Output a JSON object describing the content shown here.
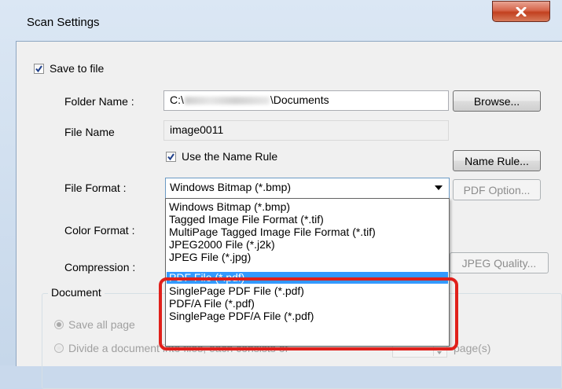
{
  "window": {
    "title": "Scan Settings",
    "close_icon": "close-x-icon"
  },
  "save_to_file": {
    "label": "Save to file",
    "checked": true
  },
  "folder": {
    "label": "Folder Name :",
    "value_prefix": "C:\\",
    "value_suffix": "\\Documents",
    "browse_label": "Browse..."
  },
  "file_name": {
    "label": "File Name",
    "value": "image0011"
  },
  "name_rule": {
    "checkbox_label": "Use the Name Rule",
    "checked": true,
    "button_label": "Name Rule..."
  },
  "file_format": {
    "label": "File Format :",
    "selected": "Windows Bitmap (*.bmp)",
    "pdf_option_label": "PDF Option...",
    "options": [
      "Windows Bitmap (*.bmp)",
      "Tagged Image File Format (*.tif)",
      "MultiPage Tagged Image File Format (*.tif)",
      "JPEG2000 File (*.j2k)",
      "JPEG File (*.jpg)",
      "PDF File (*.pdf)",
      "SinglePage PDF File (*.pdf)",
      "PDF/A File (*.pdf)",
      "SinglePage PDF/A File (*.pdf)"
    ],
    "highlighted_option": "PDF File (*.pdf)"
  },
  "color_format": {
    "label": "Color Format :"
  },
  "compression": {
    "label": "Compression :",
    "jpeg_quality_label": "JPEG Quality..."
  },
  "document": {
    "group_label": "Document",
    "radio_save_all": "Save all page",
    "radio_divide": "Divide a document into files, each consists of",
    "pages_unit": "page(s)"
  },
  "annotation": {
    "highlight_color": "#e0201b"
  }
}
